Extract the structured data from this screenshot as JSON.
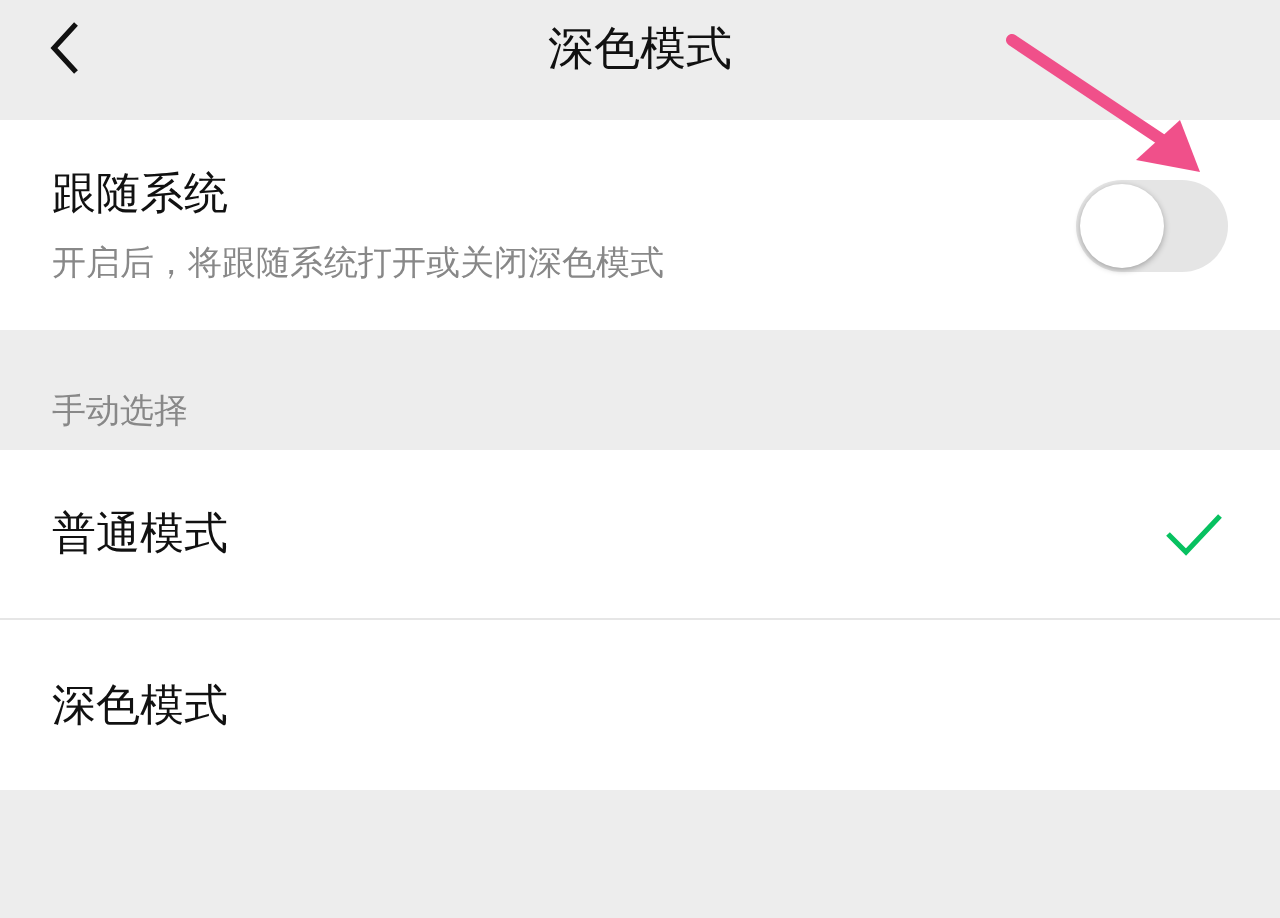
{
  "header": {
    "title": "深色模式"
  },
  "follow_system": {
    "title": "跟随系统",
    "description": "开启后，将跟随系统打开或关闭深色模式",
    "on": false
  },
  "manual": {
    "label": "手动选择",
    "options": [
      {
        "label": "普通模式",
        "selected": true
      },
      {
        "label": "深色模式",
        "selected": false
      }
    ]
  }
}
